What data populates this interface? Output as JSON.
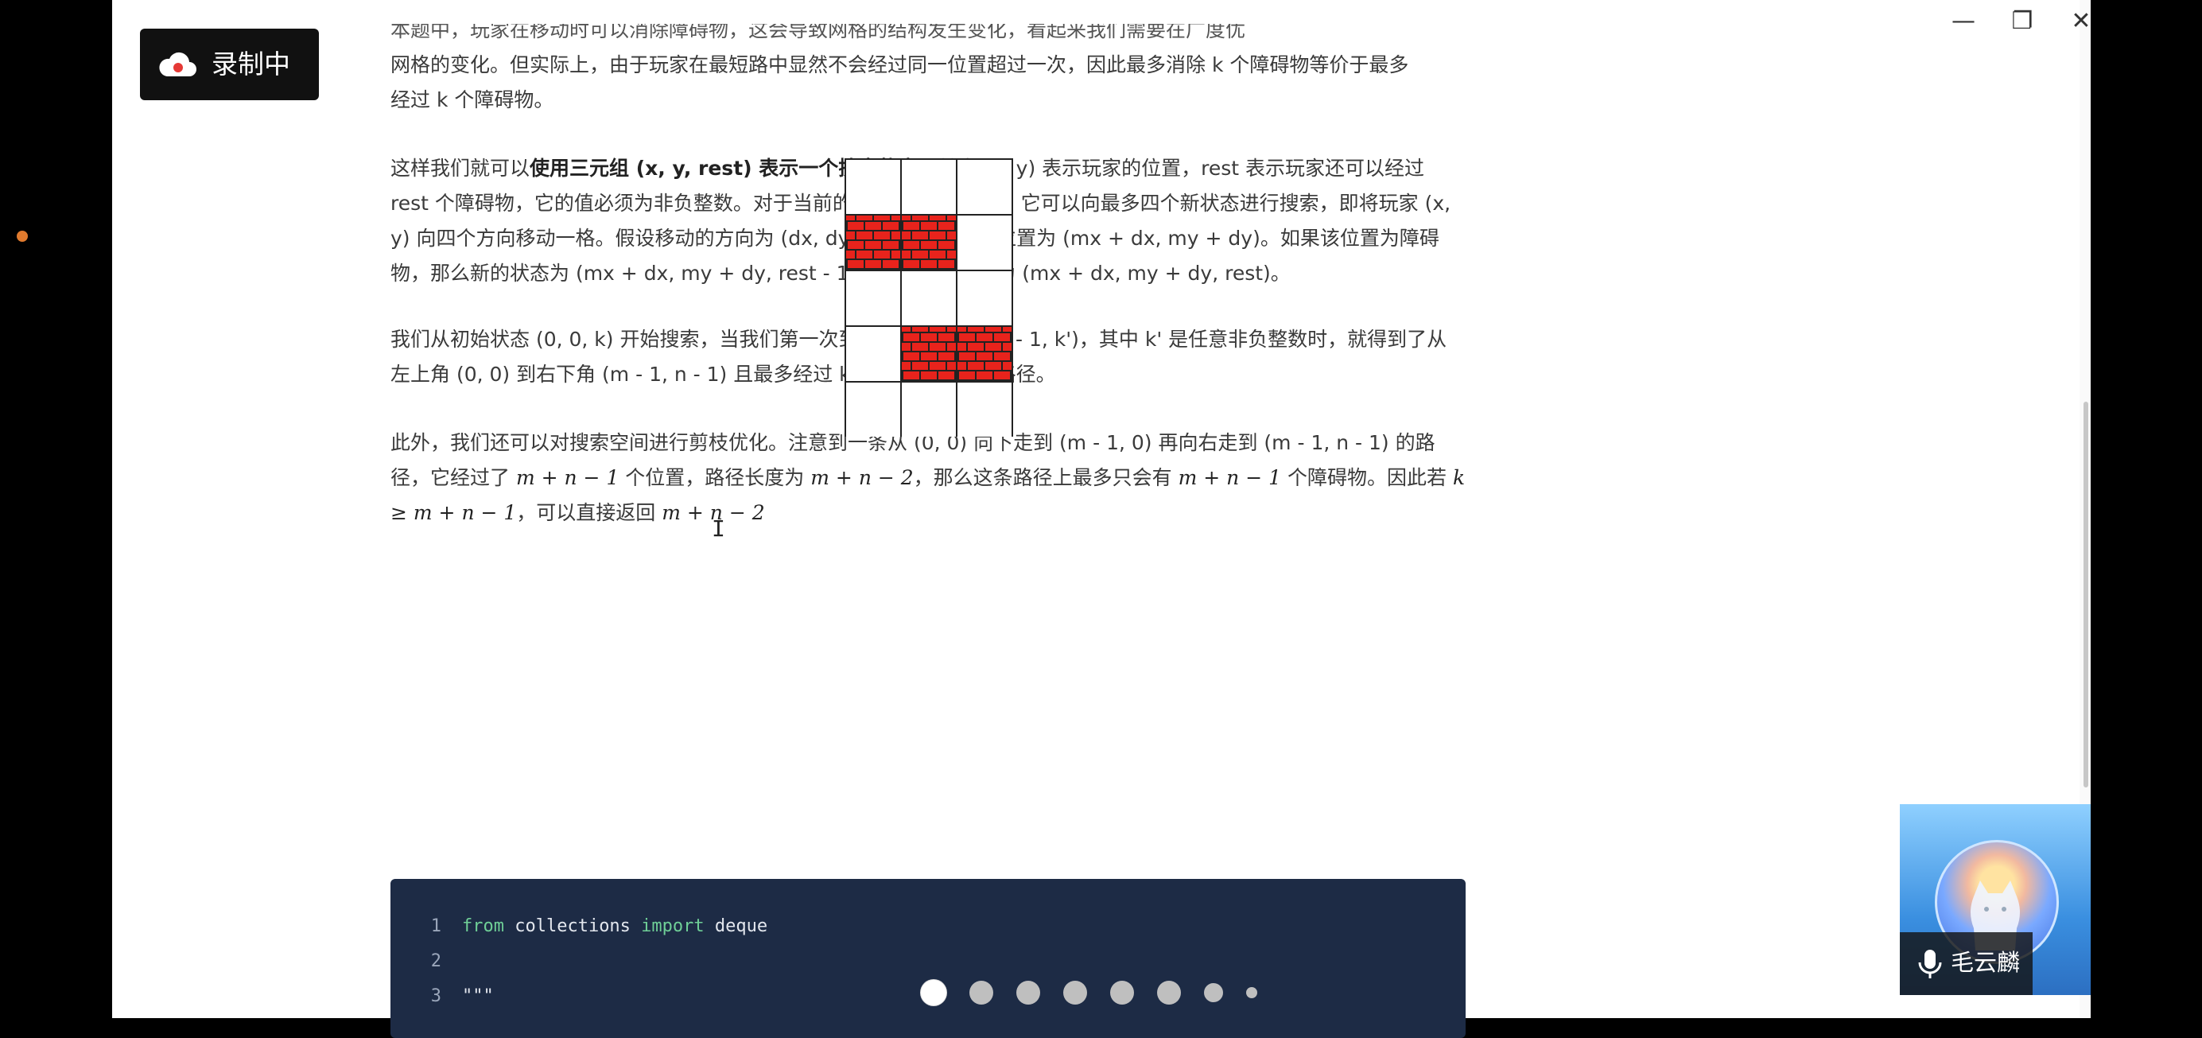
{
  "window": {
    "controls": {
      "minimize": "—",
      "maximize": "❐",
      "close": "✕"
    }
  },
  "article": {
    "top_line": "本题中，玩家在移动时可以消除障碍物，这会导致网格的结构发生变化，看起来我们需要在广度优",
    "intro_line_2": "网格的变化。但实际上，由于玩家在最短路中显然不会经过同一位置超过一次，因此最多消除 k 个障碍物等价于最多",
    "intro_line_3": "经过 k 个障碍物。",
    "p1_prefix": "这样我们就可以",
    "p1_bold": "使用三元组 (x, y, rest) 表示一个搜索状态",
    "p1_rest": "，其中 (x, y) 表示玩家的位置，rest 表示玩家还可以经过 rest 个障碍物，它的值必须为非负整数。对于当前的状态 (x, y, rest)，它可以向最多四个新状态进行搜索，即将玩家 (x, y) 向四个方向移动一格。假设移动的方向为 (dx, dy)，那么玩家的新位置为 (mx + dx, my + dy)。如果该位置为障碍物，那么新的状态为 (mx + dx, my + dy, rest - 1)，否则新的状态为 (mx + dx, my + dy, rest)。",
    "p2": "我们从初始状态 (0, 0, k) 开始搜索，当我们第一次到达状态 (m - 1, n - 1, k')，其中 k' 是任意非负整数时，就得到了从左上角 (0, 0) 到右下角 (m - 1, n - 1) 且最多经过 k 个障碍物的最短路径。",
    "p3_a": "此外，我们还可以对搜索空间进行剪枝优化。注意到一条从 (0, 0) 向下走到 (m - 1, 0) 再向右走到 (m - 1, n - 1) 的路径，它经过了 ",
    "p3_math1": "m + n − 1",
    "p3_b": " 个位置，路径长度为 ",
    "p3_math2": "m + n − 2",
    "p3_c": "，那么这条路径上最多只会有 ",
    "p3_math3": "m + n − 1",
    "p3_d": " 个障碍物。因此若 ",
    "p3_math4": "k ≥ m + n − 1",
    "p3_e": "，可以直接返回 ",
    "p3_math5": "m + n − 2"
  },
  "grid_figure": {
    "rows": 5,
    "cols": 3,
    "walls": [
      [
        1,
        0
      ],
      [
        1,
        1
      ],
      [
        3,
        1
      ],
      [
        3,
        2
      ]
    ]
  },
  "code": {
    "lines": [
      {
        "n": "1",
        "kw1": "from",
        "t1": " collections ",
        "kw2": "import",
        "t2": " deque"
      },
      {
        "n": "2",
        "kw1": "",
        "t1": "",
        "kw2": "",
        "t2": ""
      },
      {
        "n": "3",
        "kw1": "",
        "t1": "\"\"\"",
        "kw2": "",
        "t2": ""
      }
    ]
  },
  "pager": {
    "dot_count": 8,
    "active_index": 0
  },
  "recording": {
    "label": "录制中"
  },
  "camera": {
    "name": "毛云麟"
  }
}
